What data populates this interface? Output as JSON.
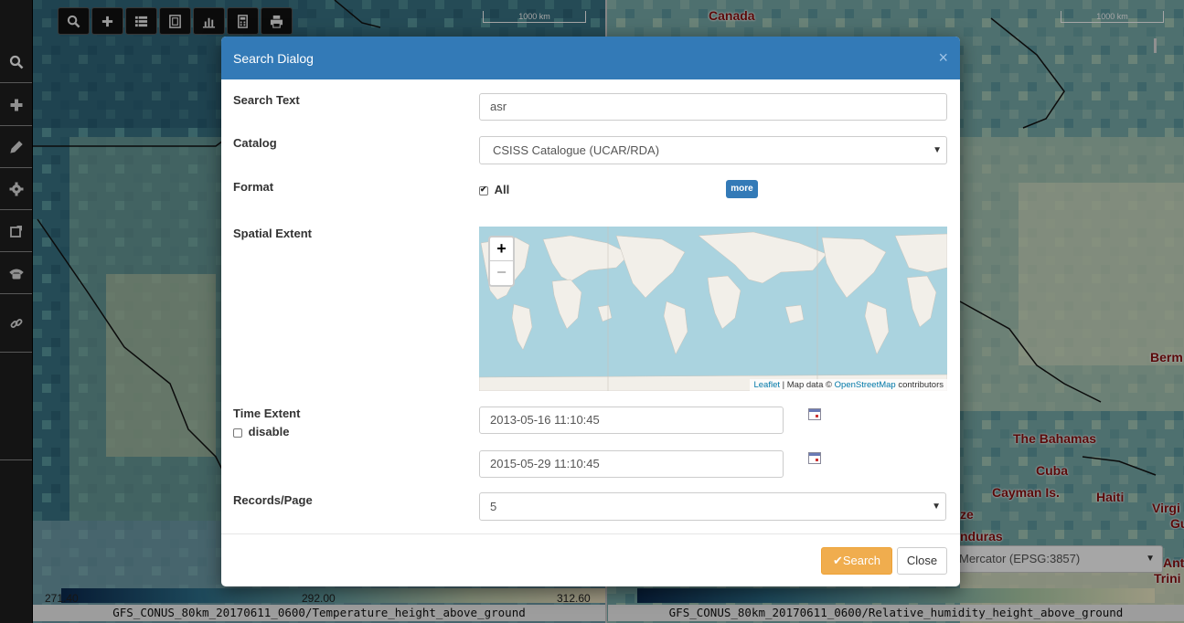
{
  "sidebar": {
    "items": [
      {
        "icon": "search-icon"
      },
      {
        "icon": "plus-icon"
      },
      {
        "icon": "pencil-icon"
      },
      {
        "icon": "gear-icon"
      },
      {
        "icon": "share-icon"
      },
      {
        "icon": "phone-icon"
      },
      {
        "icon": "link-icon"
      }
    ]
  },
  "map_toolbar": {
    "buttons": [
      "search-icon",
      "plus-icon",
      "list-icon",
      "film-icon",
      "bar-chart-icon",
      "calculator-icon",
      "print-icon"
    ]
  },
  "map_left": {
    "scale": "1000 km",
    "legend_min": "271.40",
    "legend_mid": "292.00",
    "legend_max": "312.60",
    "layer": "GFS_CONUS_80km_20170611_0600/Temperature_height_above_ground"
  },
  "map_right": {
    "scale": "1000 km",
    "labels": [
      "Canada",
      "The Bahamas",
      "Cuba",
      "Cayman Is.",
      "Haiti",
      "Berm",
      "Virgi",
      "Gu",
      "Trini",
      "ze",
      "nduras",
      "Anti"
    ],
    "projection": "Mercator (EPSG:3857)",
    "layer": "GFS_CONUS_80km_20170611_0600/Relative_humidity_height_above_ground"
  },
  "dialog": {
    "title": "Search Dialog",
    "close_symbol": "×",
    "search_text_label": "Search Text",
    "search_text_value": "asr",
    "catalog_label": "Catalog",
    "catalog_value": "CSISS Catalogue (UCAR/RDA)",
    "format_label": "Format",
    "format_all_label": "All",
    "format_all_checked": true,
    "more_label": "more",
    "spatial_label": "Spatial Extent",
    "zoom_in": "+",
    "zoom_out": "−",
    "attribution_leaflet": "Leaflet",
    "attribution_mid": " | Map data © ",
    "attribution_osm": "OpenStreetMap",
    "attribution_end": " contributors",
    "time_label": "Time Extent",
    "time_disable_label": "disable",
    "time_start": "2013-05-16 11:10:45",
    "time_end": "2015-05-29 11:10:45",
    "records_label": "Records/Page",
    "records_value": "5",
    "search_button": "Search",
    "close_button": "Close"
  },
  "colors": {
    "header": "#337ab7",
    "search_button": "#f0ad4e",
    "map_label": "#8b0f0f"
  }
}
